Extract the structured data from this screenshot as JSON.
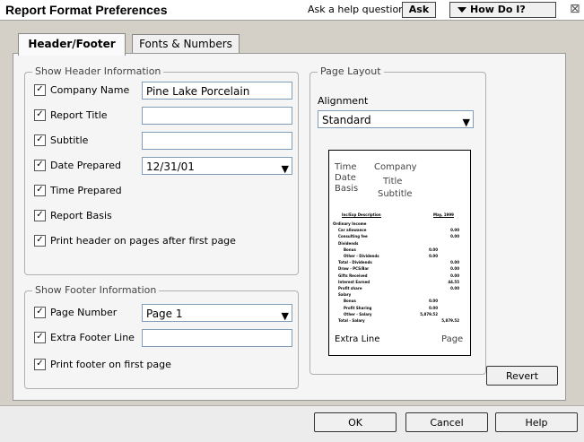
{
  "window": {
    "title": "Report Format Preferences",
    "help_label": "Ask a help question",
    "ask_label": "Ask",
    "howdoi_label": "How Do I?",
    "close_glyph": "⊠"
  },
  "tabs": [
    {
      "label": "Header/Footer",
      "active": true
    },
    {
      "label": "Fonts & Numbers",
      "active": false
    }
  ],
  "header": {
    "group_label": "Show Header Information",
    "company_name": {
      "label": "Company Name",
      "checked": true,
      "value": "Pine Lake Porcelain"
    },
    "report_title": {
      "label": "Report Title",
      "checked": true,
      "value": ""
    },
    "subtitle": {
      "label": "Subtitle",
      "checked": true,
      "value": ""
    },
    "date_prepared": {
      "label": "Date Prepared",
      "checked": true,
      "value": "12/31/01"
    },
    "time_prepared": {
      "label": "Time Prepared",
      "checked": true
    },
    "report_basis": {
      "label": "Report Basis",
      "checked": true
    },
    "print_header": {
      "label": "Print header on pages after first page",
      "checked": true
    }
  },
  "footer": {
    "group_label": "Show Footer Information",
    "page_number": {
      "label": "Page Number",
      "checked": true,
      "value": "Page 1"
    },
    "extra_footer": {
      "label": "Extra Footer Line",
      "checked": true,
      "value": ""
    },
    "print_footer": {
      "label": "Print footer on first page",
      "checked": true
    }
  },
  "layout": {
    "group_label": "Page Layout",
    "alignment_label": "Alignment",
    "alignment_value": "Standard",
    "preview": {
      "time": "Time",
      "date": "Date",
      "basis": "Basis",
      "company": "Company",
      "title": "Title",
      "subtitle": "Subtitle",
      "col1": "Inc/Exp Description",
      "col2": "May, 1999",
      "lines": [
        {
          "t": "Ordinary Income",
          "v": "",
          "ind": 0
        },
        {
          "t": "Car allowance",
          "v": "0.00",
          "ind": 1
        },
        {
          "t": "Consulting fee",
          "v": "0.00",
          "ind": 1
        },
        {
          "t": "Dividends",
          "v": "",
          "ind": 1
        },
        {
          "t": "Bonus",
          "v": "0.00",
          "ind": 2
        },
        {
          "t": "Other - Dividends",
          "v": "0.00",
          "ind": 2
        },
        {
          "t": "Total - Dividends",
          "v": "0.00",
          "ind": 1
        },
        {
          "t": "Draw - PCS/Bar",
          "v": "0.00",
          "ind": 1
        },
        {
          "t": "Gifts Received",
          "v": "0.00",
          "ind": 1
        },
        {
          "t": "Interest Earned",
          "v": "44.55",
          "ind": 1
        },
        {
          "t": "Profit share",
          "v": "0.00",
          "ind": 1
        },
        {
          "t": "Salary",
          "v": "",
          "ind": 1
        },
        {
          "t": "Bonus",
          "v": "0.00",
          "ind": 2
        },
        {
          "t": "Profit Sharing",
          "v": "0.00",
          "ind": 2
        },
        {
          "t": "Other - Salary",
          "v": "5,879.52",
          "ind": 2
        },
        {
          "t": "Total - Salary",
          "v": "5,879.52",
          "ind": 1
        }
      ],
      "extra_line": "Extra Line",
      "page": "Page"
    }
  },
  "buttons": {
    "revert": "Revert",
    "ok": "OK",
    "cancel": "Cancel",
    "help": "Help"
  }
}
